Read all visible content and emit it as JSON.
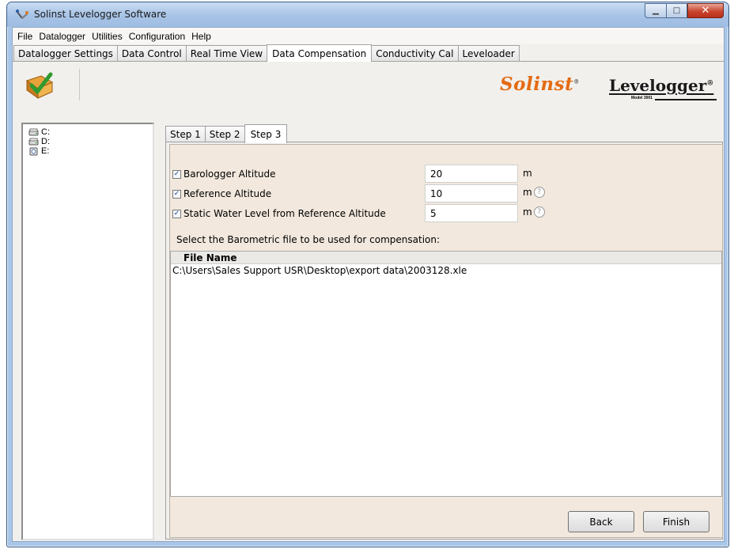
{
  "window": {
    "title": "Solinst Levelogger Software",
    "controls": {
      "minimize": "▁",
      "maximize": "□",
      "close": "✕"
    }
  },
  "menu": [
    "File",
    "Datalogger",
    "Utilities",
    "Configuration",
    "Help"
  ],
  "top_tabs": [
    {
      "label": "Datalogger Settings",
      "active": false
    },
    {
      "label": "Data Control",
      "active": false
    },
    {
      "label": "Real Time View",
      "active": false
    },
    {
      "label": "Data Compensation",
      "active": true
    },
    {
      "label": "Conductivity Cal",
      "active": false
    },
    {
      "label": "Leveloader",
      "active": false
    }
  ],
  "toolbar": {
    "export_icon": "export-checkmark-icon"
  },
  "logos": {
    "solinst": "Solinst",
    "levelogger": "Levelogger",
    "model": "Model 3001"
  },
  "drives": [
    {
      "label": "C:",
      "icon": "hard-drive-icon"
    },
    {
      "label": "D:",
      "icon": "hard-drive-icon"
    },
    {
      "label": "E:",
      "icon": "removable-drive-icon"
    }
  ],
  "step_tabs": [
    {
      "label": "Step 1",
      "active": false
    },
    {
      "label": "Step 2",
      "active": false
    },
    {
      "label": "Step 3",
      "active": true
    }
  ],
  "form": {
    "barologger_altitude": {
      "label": "Barologger Altitude",
      "checked": true,
      "value": "20",
      "unit": "m",
      "help": false
    },
    "reference_altitude": {
      "label": "Reference Altitude",
      "checked": true,
      "value": "10",
      "unit": "m",
      "help": true
    },
    "static_water_level": {
      "label": "Static Water Level from Reference Altitude",
      "checked": true,
      "value": "5",
      "unit": "m",
      "help": true
    },
    "check_glyph": "✓",
    "help_glyph": "?"
  },
  "select_prompt": "Select the Barometric file to be used for compensation:",
  "file_table": {
    "header": "File Name",
    "rows": [
      "C:\\Users\\Sales Support USR\\Desktop\\export data\\2003128.xle"
    ]
  },
  "buttons": {
    "back": "Back",
    "finish": "Finish"
  }
}
